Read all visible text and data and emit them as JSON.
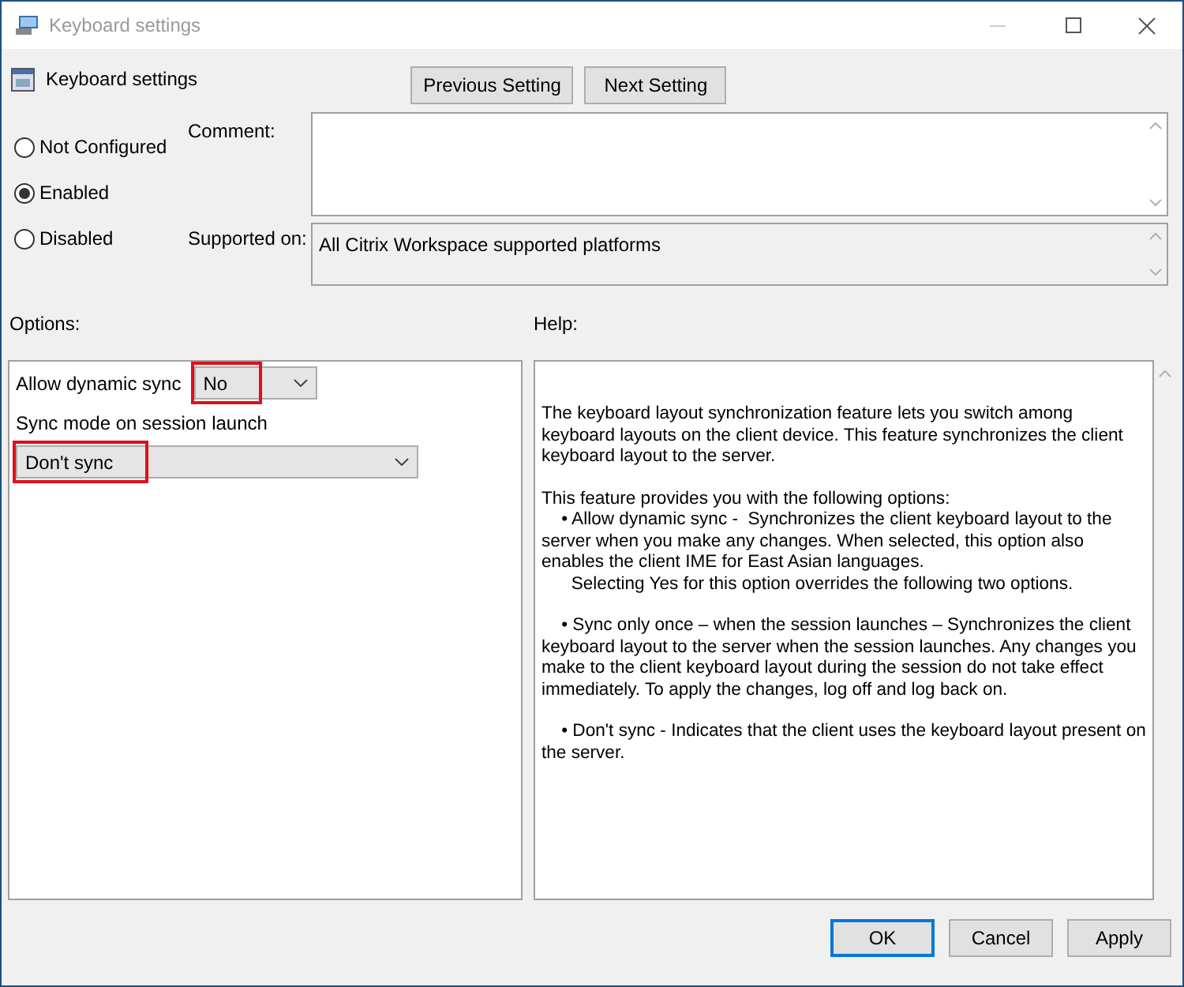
{
  "window": {
    "title": "Keyboard settings"
  },
  "header": {
    "title": "Keyboard settings"
  },
  "nav_buttons": [
    "Previous Setting",
    "Next Setting"
  ],
  "radios": [
    {
      "label": "Not Configured",
      "selected": false
    },
    {
      "label": "Enabled",
      "selected": true
    },
    {
      "label": "Disabled",
      "selected": false
    }
  ],
  "comment": {
    "label": "Comment:"
  },
  "supported_on": {
    "label": "Supported on:",
    "value": "All Citrix Workspace supported platforms"
  },
  "options": {
    "label": "Options:",
    "dynamic_sync": {
      "label": "Allow dynamic sync",
      "value": "No",
      "highlighted": true
    },
    "sync_mode": {
      "label": "Sync mode on session launch",
      "value": "Don't sync",
      "highlighted": true
    }
  },
  "help": {
    "label": "Help:",
    "paragraphs": [
      "The keyboard layout synchronization feature lets you switch among keyboard layouts on the client device. This feature synchronizes the client keyboard layout to the server.",
      "This feature provides you with the following options:\n    • Allow dynamic sync -  Synchronizes the client keyboard layout to the server when you make any changes. When selected, this option also enables the client IME for East Asian languages.\n      Selecting Yes for this option overrides the following two options.",
      "    • Sync only once – when the session launches – Synchronizes the client keyboard layout to the server when the session launches. Any changes you make to the client keyboard layout during the session do not take effect immediately. To apply the changes, log off and log back on.",
      "    • Don't sync - Indicates that the client uses the keyboard layout present on the server."
    ]
  },
  "buttons": [
    {
      "label": "OK",
      "selected": true
    },
    {
      "label": "Cancel",
      "selected": false
    },
    {
      "label": "Apply",
      "selected": false
    }
  ]
}
